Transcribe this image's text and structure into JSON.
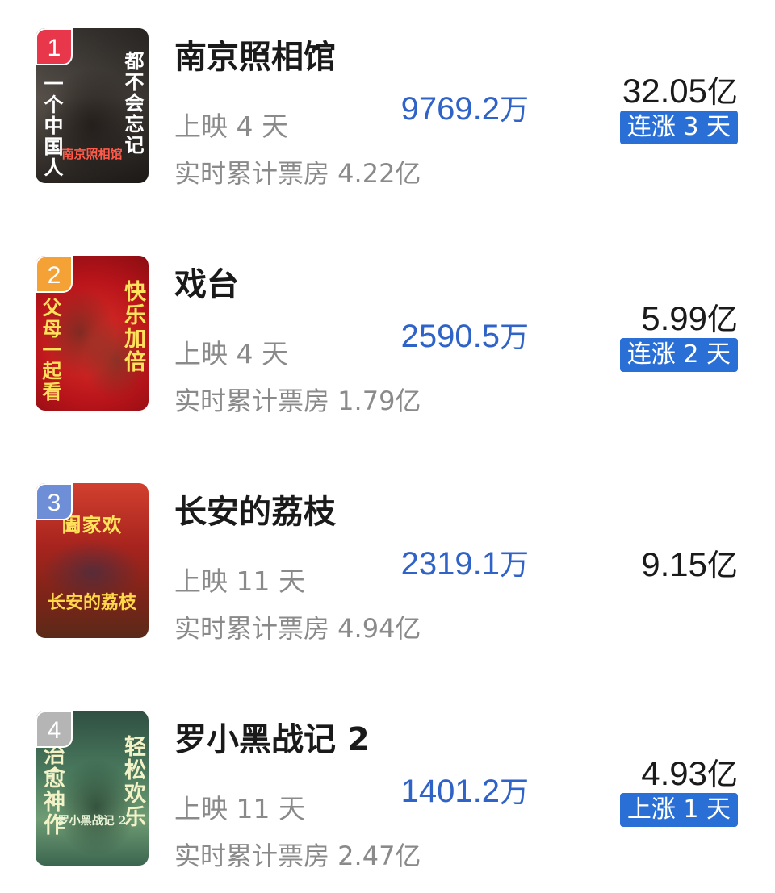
{
  "colors": {
    "daily_value": "#2f63c8",
    "trend_badge": "#2a6fd6",
    "rank_colors": [
      "#e8364a",
      "#f4a236",
      "#6e8fd8",
      "#b5b5b5"
    ]
  },
  "movies": [
    {
      "rank": "1",
      "title": "南京照相馆",
      "days": "上映 4 天",
      "cumulative": "实时累计票房 4.22亿",
      "daily_value": "9769.2",
      "daily_unit": "万",
      "total_value": "32.05",
      "total_unit": "亿",
      "trend": "连涨 3 天",
      "poster": {
        "left_text": "一个中国人",
        "right_text": "都不会忘记",
        "logo_text": "南京照相馆"
      }
    },
    {
      "rank": "2",
      "title": "戏台",
      "days": "上映 4 天",
      "cumulative": "实时累计票房 1.79亿",
      "daily_value": "2590.5",
      "daily_unit": "万",
      "total_value": "5.99",
      "total_unit": "亿",
      "trend": "连涨 2 天",
      "poster": {
        "left_text": "父母一起看",
        "right_text": "快乐加倍"
      }
    },
    {
      "rank": "3",
      "title": "长安的荔枝",
      "days": "上映 11 天",
      "cumulative": "实时累计票房 4.94亿",
      "daily_value": "2319.1",
      "daily_unit": "万",
      "total_value": "9.15",
      "total_unit": "亿",
      "trend": "",
      "poster": {
        "top_text": "阖家欢",
        "logo_text": "长安的荔枝"
      }
    },
    {
      "rank": "4",
      "title": "罗小黑战记 2",
      "days": "上映 11 天",
      "cumulative": "实时累计票房 2.47亿",
      "daily_value": "1401.2",
      "daily_unit": "万",
      "total_value": "4.93",
      "total_unit": "亿",
      "trend": "上涨 1 天",
      "poster": {
        "left_text": "治愈神作",
        "right_text": "轻松欢乐",
        "logo_text": "罗小黑战记 2"
      }
    }
  ]
}
